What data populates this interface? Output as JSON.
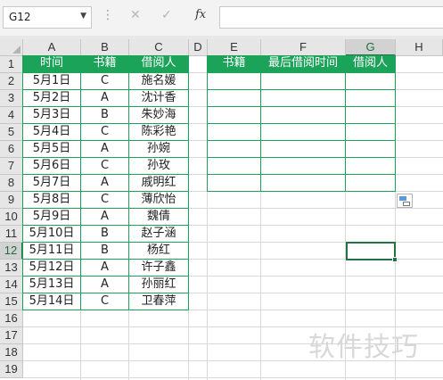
{
  "formula_bar": {
    "name_box": "G12",
    "cancel_icon": "✕",
    "enter_icon": "✓",
    "fx_label": "fx",
    "formula": ""
  },
  "columns": [
    "A",
    "B",
    "C",
    "D",
    "E",
    "F",
    "G",
    "H"
  ],
  "rows": [
    "1",
    "2",
    "3",
    "4",
    "5",
    "6",
    "7",
    "8",
    "9",
    "10",
    "11",
    "12",
    "13",
    "14",
    "15",
    "16",
    "17",
    "18",
    "19"
  ],
  "selected_cell": "G12",
  "colors": {
    "header_fill": "#1ca35a",
    "selection": "#217346"
  },
  "table1": {
    "headers": [
      "时间",
      "书籍",
      "借阅人"
    ],
    "rows": [
      [
        "5月1日",
        "C",
        "施名媛"
      ],
      [
        "5月2日",
        "A",
        "沈计香"
      ],
      [
        "5月3日",
        "B",
        "朱妙海"
      ],
      [
        "5月4日",
        "C",
        "陈彩艳"
      ],
      [
        "5月5日",
        "A",
        "孙婉"
      ],
      [
        "5月6日",
        "C",
        "孙玫"
      ],
      [
        "5月7日",
        "A",
        "戚明红"
      ],
      [
        "5月8日",
        "C",
        "薄欣怡"
      ],
      [
        "5月9日",
        "A",
        "魏倩"
      ],
      [
        "5月10日",
        "B",
        "赵子涵"
      ],
      [
        "5月11日",
        "B",
        "杨红"
      ],
      [
        "5月12日",
        "A",
        "许子鑫"
      ],
      [
        "5月13日",
        "A",
        "孙丽红"
      ],
      [
        "5月14日",
        "C",
        "卫春萍"
      ]
    ]
  },
  "table2": {
    "headers": [
      "书籍",
      "最后借阅时间",
      "借阅人"
    ],
    "empty_rows": 7
  },
  "watermark": "软件技巧"
}
